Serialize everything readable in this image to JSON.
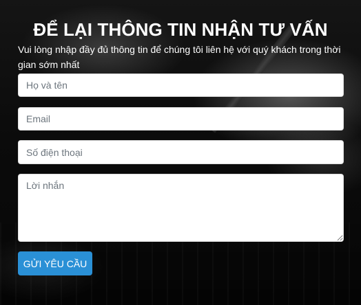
{
  "form": {
    "title": "ĐỂ LẠI THÔNG TIN NHẬN TƯ VẤN",
    "description": "Vui lòng nhập đầy đủ thông tin để chúng tôi liên hệ với quý khách trong thời gian sớm nhất",
    "fields": {
      "name_placeholder": "Họ và tên",
      "email_placeholder": "Email",
      "phone_placeholder": "Số điện thoại",
      "message_placeholder": "Lời nhắn"
    },
    "submit_label": "GỬI YÊU CẦU"
  },
  "colors": {
    "accent": "#2a90d6",
    "background": "#0b0b0b",
    "text": "#ffffff"
  }
}
